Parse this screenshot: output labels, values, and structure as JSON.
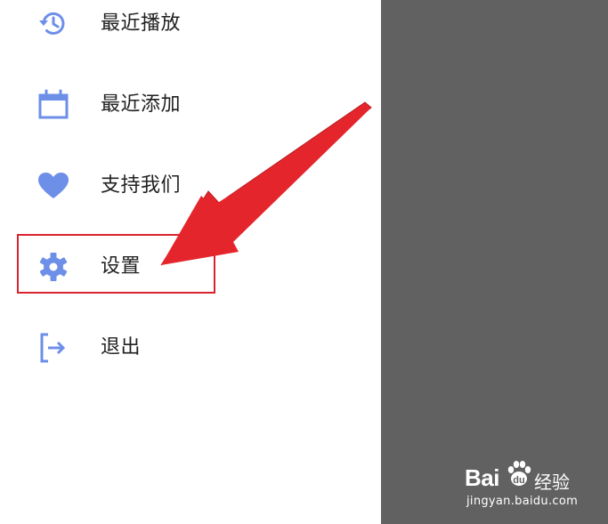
{
  "menu": {
    "items": [
      {
        "label": "最近播放",
        "icon": "history-icon"
      },
      {
        "label": "最近添加",
        "icon": "calendar-icon"
      },
      {
        "label": "支持我们",
        "icon": "heart-icon"
      },
      {
        "label": "设置",
        "icon": "gear-icon"
      },
      {
        "label": "退出",
        "icon": "logout-icon"
      }
    ]
  },
  "colors": {
    "icon": "#6d8fe8",
    "annotation": "#d9232e",
    "scrim": "#616161"
  },
  "watermark": {
    "logo": "Bai",
    "logo_suffix": "经验",
    "url": "jingyan.baidu.com"
  }
}
